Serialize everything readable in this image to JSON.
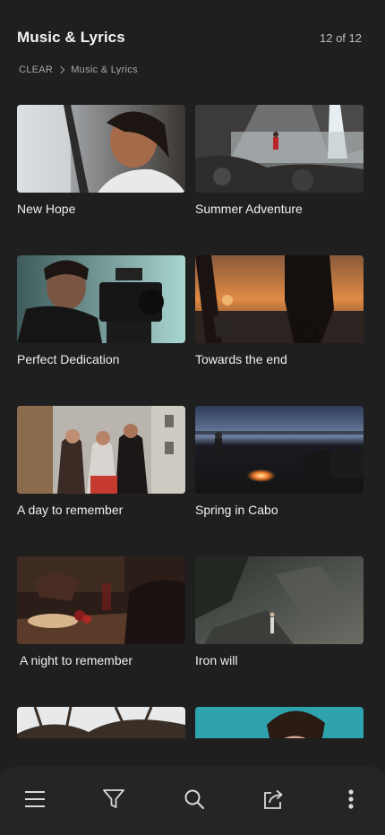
{
  "header": {
    "title": "Music & Lyrics",
    "count": "12 of 12"
  },
  "breadcrumb": {
    "root": "CLEAR",
    "current": "Music & Lyrics"
  },
  "items": [
    {
      "title": "New Hope"
    },
    {
      "title": "Summer Adventure"
    },
    {
      "title": "Perfect Dedication"
    },
    {
      "title": "Towards the end"
    },
    {
      "title": "A day to remember"
    },
    {
      "title": "Spring in Cabo"
    },
    {
      "title": "A night to remember"
    },
    {
      "title": "Iron will"
    },
    {
      "title": ""
    },
    {
      "title": ""
    }
  ],
  "toolbar": {
    "icons": [
      "menu-icon",
      "filter-icon",
      "search-icon",
      "share-icon",
      "more-vertical-icon"
    ]
  }
}
